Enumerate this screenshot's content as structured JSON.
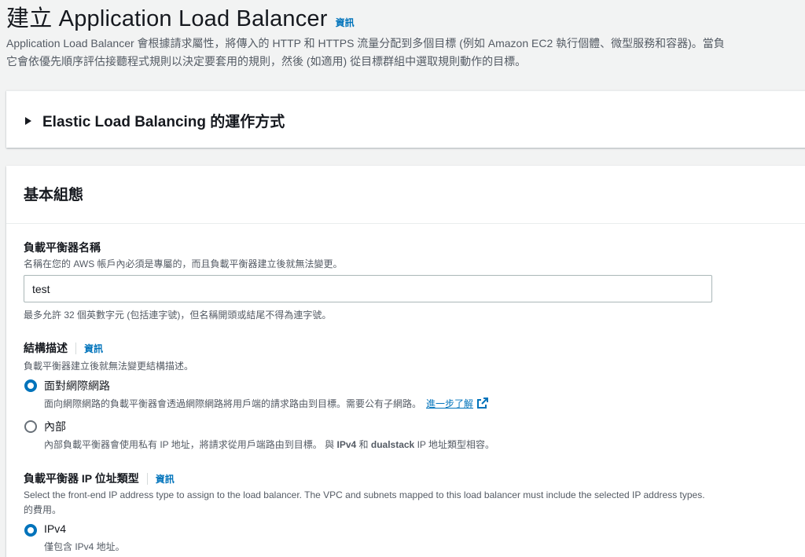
{
  "header": {
    "title": "建立 Application Load Balancer",
    "info_label": "資訊",
    "description_line1": "Application Load Balancer 會根據請求屬性，將傳入的 HTTP 和 HTTPS 流量分配到多個目標 (例如 Amazon EC2 執行個體、微型服務和容器)。當負",
    "description_line2": "它會依優先順序評估接聽程式規則以決定要套用的規則，然後 (如適用) 從目標群組中選取規則動作的目標。"
  },
  "expander": {
    "title": "Elastic Load Balancing 的運作方式"
  },
  "basic_config": {
    "title": "基本組態",
    "name_field": {
      "label": "負載平衡器名稱",
      "description": "名稱在您的 AWS 帳戶內必須是專屬的，而且負載平衡器建立後就無法變更。",
      "value": "test",
      "constraint": "最多允許 32 個英數字元 (包括連字號)，但名稱開頭或結尾不得為連字號。"
    },
    "scheme": {
      "label": "結構描述",
      "info_label": "資訊",
      "description": "負載平衡器建立後就無法變更結構描述。",
      "options": [
        {
          "label": "面對網際網路",
          "description": "面向網際網路的負載平衡器會透過網際網路將用戶端的請求路由到目標。需要公有子網路。",
          "link": "進一步了解",
          "checked": true
        },
        {
          "label": "內部",
          "description_pre": "內部負載平衡器會使用私有 IP 地址，將請求從用戶端路由到目標。 與",
          "bold1": "IPv4",
          "mid": "和",
          "bold2": "dualstack",
          "description_post": "IP 地址類型相容。",
          "checked": false
        }
      ]
    },
    "ip_type": {
      "label": "負載平衡器 IP 位址類型",
      "info_label": "資訊",
      "description_line1": "Select the front-end IP address type to assign to the load balancer. The VPC and subnets mapped to this load balancer must include the selected IP address types.",
      "description_line2": "的費用。",
      "options": [
        {
          "label": "IPv4",
          "description": "僅包含 IPv4 地址。",
          "checked": true
        }
      ]
    }
  }
}
